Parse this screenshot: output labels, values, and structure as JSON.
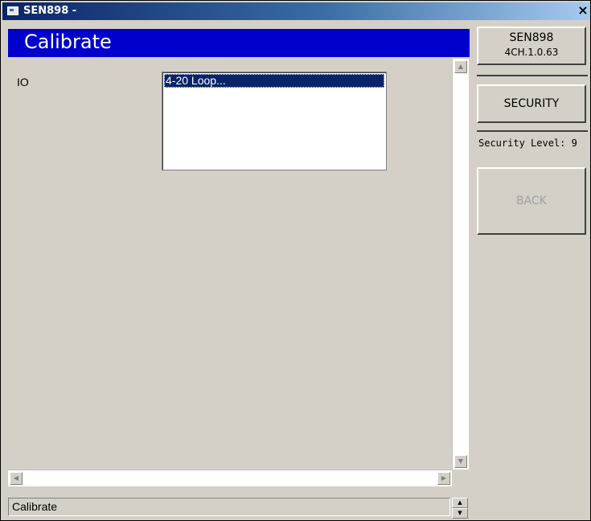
{
  "window": {
    "title": "SEN898 -",
    "close_glyph": "×"
  },
  "header": {
    "title": "Calibrate"
  },
  "form": {
    "io_label": "IO",
    "io_list": {
      "items": [
        "4-20 Loop..."
      ],
      "selected": "4-20 Loop..."
    }
  },
  "status_bar": {
    "text": "Calibrate"
  },
  "right_panel": {
    "device_name": "SEN898",
    "version": "4CH.1.0.63",
    "security_button_label": "SECURITY",
    "security_level_text": "Security Level: 9",
    "back_button_label": "BACK"
  },
  "icons": {
    "app": "app-window-icon",
    "close": "close-icon",
    "scroll_up": "scroll-up-arrow-icon",
    "scroll_down": "scroll-down-arrow-icon",
    "scroll_left": "scroll-left-arrow-icon",
    "scroll_right": "scroll-right-arrow-icon"
  },
  "colors": {
    "header_band": "#0000cc",
    "selection": "#0a246a",
    "face": "#d4d0c8",
    "disabled_text": "#a0a0a0"
  }
}
